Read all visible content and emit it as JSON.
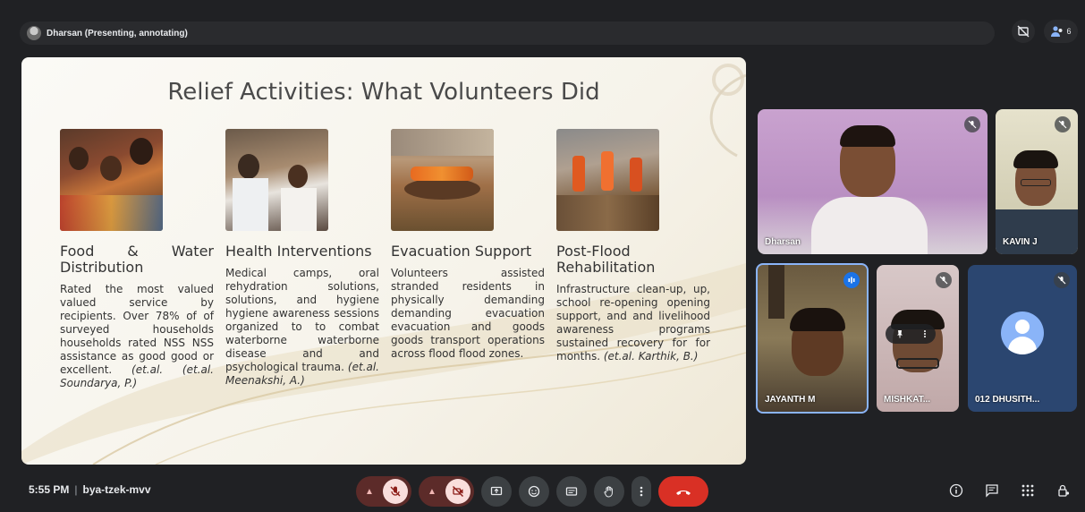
{
  "presenter": {
    "label": "Dharsan (Presenting, annotating)"
  },
  "top_icons": {
    "participants_count": "6"
  },
  "slide": {
    "title": "Relief Activities: What Volunteers Did",
    "columns": [
      {
        "heading": "Food & Water Distribution",
        "body": "Rated the most valued valued service by recipients. Over 78% of of surveyed households households rated NSS NSS assistance as good good or excellent.",
        "cite": "(et.al. (et.al. Soundarya, P.)"
      },
      {
        "heading": "Health Interventions",
        "body": "Medical camps, oral rehydration solutions, solutions, and hygiene hygiene awareness sessions organized to to combat waterborne waterborne disease and and psychological trauma.",
        "cite": "(et.al. Meenakshi, A.)"
      },
      {
        "heading": "Evacuation Support",
        "body": "Volunteers assisted stranded residents in physically demanding demanding evacuation evacuation and goods goods transport operations across flood flood zones.",
        "cite": ""
      },
      {
        "heading": "Post-Flood Rehabilitation",
        "body": "Infrastructure clean-up, up, school re-opening opening support, and and livelihood awareness programs sustained recovery for for months.",
        "cite": "(et.al. Karthik, B.)"
      }
    ]
  },
  "participants": [
    {
      "name": "Dharsan",
      "mic": "muted"
    },
    {
      "name": "KAVIN J",
      "mic": "muted"
    },
    {
      "name": "JAYANTH M",
      "mic": "speaking"
    },
    {
      "name": "MISHKAT...",
      "mic": "muted"
    },
    {
      "name": "012 DHUSITH...",
      "mic": "muted"
    }
  ],
  "meeting": {
    "time": "5:55 PM",
    "code": "bya-tzek-mvv"
  },
  "colors": {
    "end_call": "#d93025",
    "muted_bg": "#f9dedc",
    "speaking": "#1a73e8"
  }
}
